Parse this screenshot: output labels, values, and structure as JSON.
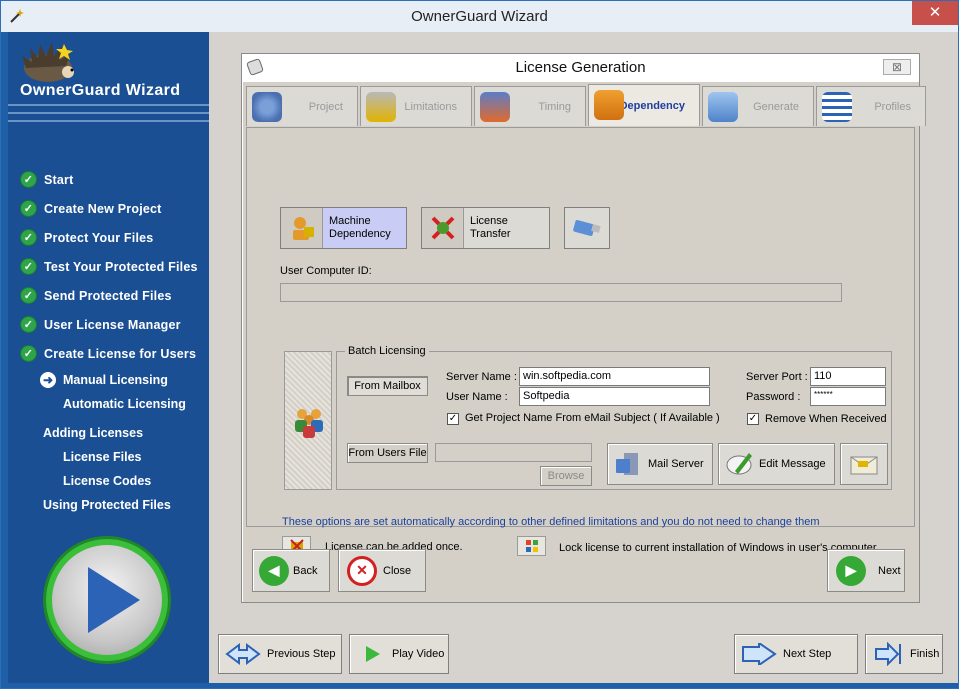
{
  "window": {
    "title": "OwnerGuard Wizard",
    "close_label": "✕"
  },
  "sidebar": {
    "brand": "OwnerGuard Wizard",
    "steps": [
      {
        "label": "Start"
      },
      {
        "label": "Create New Project"
      },
      {
        "label": "Protect Your Files"
      },
      {
        "label": "Test Your Protected Files"
      },
      {
        "label": "Send Protected Files"
      },
      {
        "label": "User License Manager"
      },
      {
        "label": "Create License for Users"
      }
    ],
    "sub_items": [
      "Manual Licensing",
      "Automatic Licensing"
    ],
    "sections": [
      {
        "label": "Adding Licenses",
        "items": [
          "License Files",
          "License Codes"
        ]
      },
      {
        "label": "Using Protected Files",
        "items": []
      }
    ]
  },
  "dialog": {
    "title": "License Generation",
    "close_label": "⊠",
    "tabs": [
      {
        "label": "Project",
        "active": false
      },
      {
        "label": "Limitations",
        "active": false
      },
      {
        "label": "Timing",
        "active": false
      },
      {
        "label": "Dependency",
        "active": true
      },
      {
        "label": "Generate",
        "active": false
      },
      {
        "label": "Profiles",
        "active": false
      }
    ],
    "mode_buttons": [
      {
        "label": "Machine Dependency",
        "line1": "Machine",
        "line2": "Dependency"
      },
      {
        "label": "License Transfer",
        "line1": "License",
        "line2": "Transfer"
      }
    ],
    "user_computer_id_label": "User Computer ID:",
    "user_computer_id_value": "",
    "batch": {
      "title": "Batch Licensing",
      "from_mailbox": "From Mailbox",
      "server_name_label": "Server Name :",
      "server_name_value": "win.softpedia.com",
      "user_name_label": "User Name :",
      "user_name_value": "Softpedia",
      "server_port_label": "Server Port :",
      "server_port_value": "110",
      "password_label": "Password :",
      "password_value": "******",
      "get_project_name": "Get Project Name From eMail Subject ( If Available )",
      "remove_when_received": "Remove When Received",
      "from_users_file": "From Users File",
      "users_file_value": "",
      "browse": "Browse",
      "mail_server": "Mail Server",
      "edit_message": "Edit Message"
    },
    "note": "These options are set automatically according to other defined limitations and you do not need to change them",
    "option1": "License can be added once.",
    "option2": "Lock license to current installation of Windows in user's computer",
    "back": "Back",
    "close": "Close",
    "next": "Next"
  },
  "footer": {
    "previous_step": "Previous Step",
    "play_video": "Play Video",
    "next_step": "Next Step",
    "finish": "Finish"
  },
  "colors": {
    "sidebar": "#1b4f93",
    "accent_blue": "#1a3f9c",
    "green": "#2ea54a",
    "close_red": "#c7514a"
  }
}
